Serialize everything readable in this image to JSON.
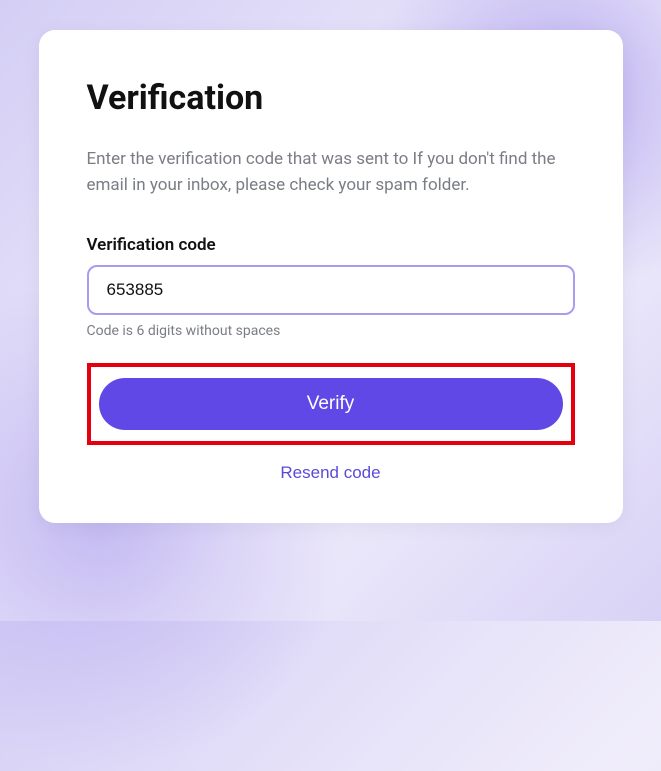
{
  "title": "Verification",
  "description_part1": "Enter the verification code that was sent to ",
  "description_email": " ",
  "description_part2": " If you don't find the email in your inbox, please check your spam folder.",
  "field": {
    "label": "Verification code",
    "value": "653885",
    "hint": "Code is 6 digits without spaces"
  },
  "actions": {
    "verify_label": "Verify",
    "resend_label": "Resend code"
  },
  "colors": {
    "accent": "#6048e6",
    "highlight_border": "#e6000d",
    "input_border": "#a99bf2"
  }
}
